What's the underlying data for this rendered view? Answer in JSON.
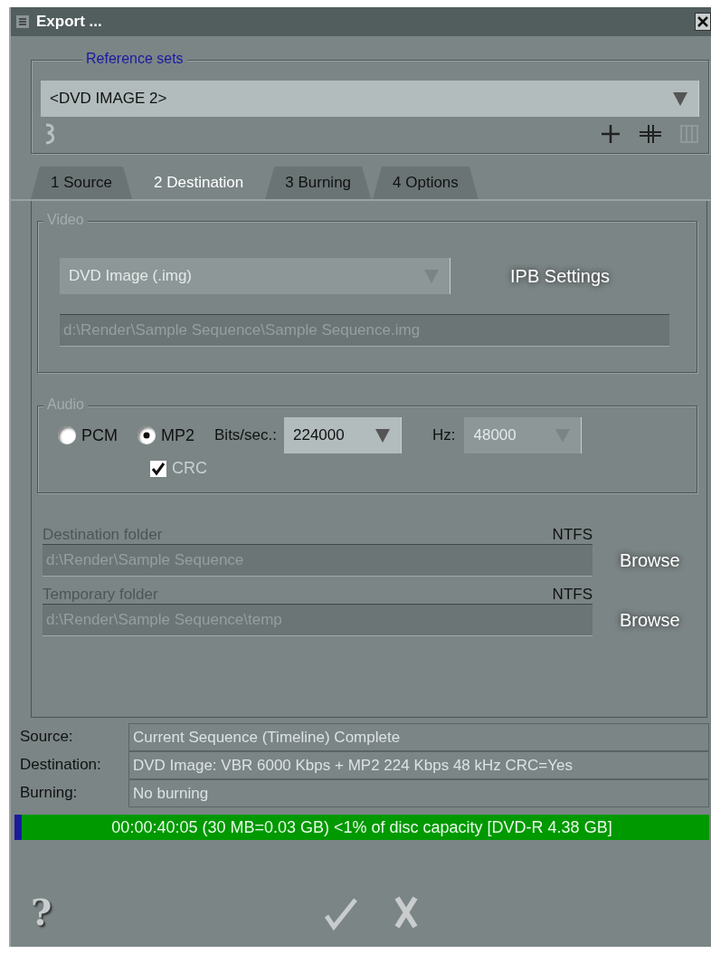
{
  "window": {
    "title": "Export ..."
  },
  "reference_sets": {
    "legend": "Reference sets",
    "value": "<DVD IMAGE 2>"
  },
  "tabs": [
    {
      "label": "1 Source",
      "selected": false
    },
    {
      "label": "2 Destination",
      "selected": true
    },
    {
      "label": "3 Burning",
      "selected": false
    },
    {
      "label": "4 Options",
      "selected": false
    }
  ],
  "video": {
    "legend": "Video",
    "format": {
      "value": "DVD Image (.img)",
      "disabled": true
    },
    "settings_button": "IPB Settings",
    "path": "d:\\Render\\Sample Sequence\\Sample Sequence.img"
  },
  "audio": {
    "legend": "Audio",
    "modes": [
      {
        "label": "PCM",
        "selected": false
      },
      {
        "label": "MP2",
        "selected": true
      }
    ],
    "bitrate": {
      "label": "Bits/sec.:",
      "value": "224000",
      "disabled": false
    },
    "hz": {
      "label": "Hz:",
      "value": "48000",
      "disabled": true
    },
    "crc": {
      "label": "CRC",
      "checked": true
    }
  },
  "folders": [
    {
      "label": "Destination folder",
      "fs": "NTFS",
      "path": "d:\\Render\\Sample Sequence",
      "button": "Browse"
    },
    {
      "label": "Temporary folder",
      "fs": "NTFS",
      "path": "d:\\Render\\Sample Sequence\\temp",
      "button": "Browse"
    }
  ],
  "summary": [
    {
      "label": "Source:",
      "value": "Current Sequence (Timeline) Complete"
    },
    {
      "label": "Destination:",
      "value": "DVD Image: VBR 6000 Kbps + MP2 224 Kbps 48 kHz CRC=Yes"
    },
    {
      "label": "Burning:",
      "value": "No burning"
    }
  ],
  "capacity": {
    "text": "00:00:40:05 (30 MB=0.03 GB) <1% of disc capacity [DVD-R 4.38 GB]",
    "level": 0.01
  },
  "help": "?"
}
